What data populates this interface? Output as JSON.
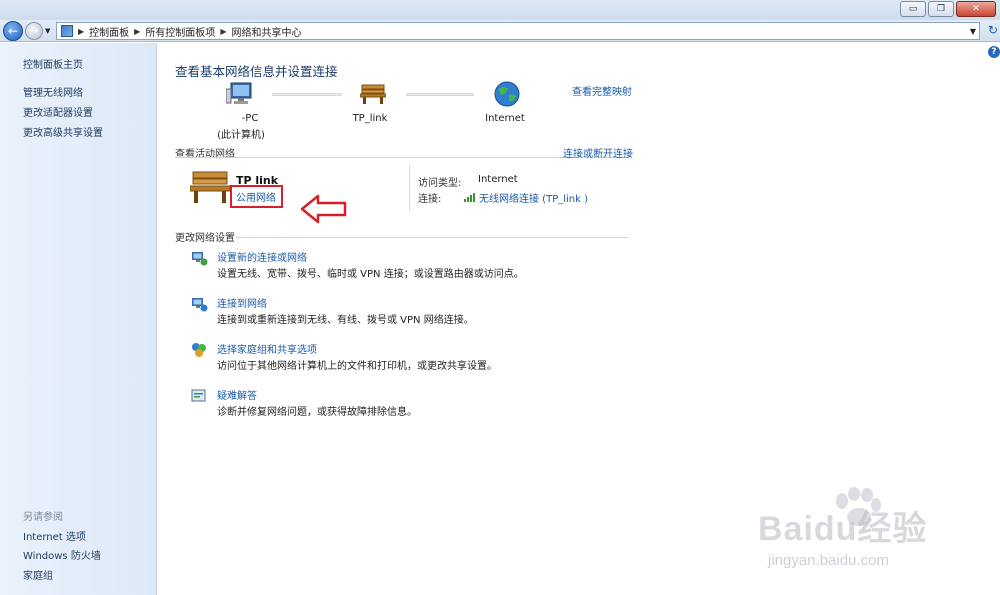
{
  "window": {
    "min_label": "▭",
    "max_label": "❐",
    "close_label": "✕"
  },
  "address": {
    "crumbs": [
      "控制面板",
      "所有控制面板项",
      "网络和共享中心"
    ]
  },
  "sidebar": {
    "items": [
      "控制面板主页",
      "管理无线网络",
      "更改适配器设置",
      "更改高级共享设置"
    ],
    "see_also_heading": "另请参阅",
    "see_also": [
      "Internet 选项",
      "Windows 防火墙",
      "家庭组"
    ]
  },
  "main": {
    "title": "查看基本网络信息并设置连接",
    "full_map_link": "查看完整映射",
    "nodes": {
      "pc_name": "-PC",
      "pc_sub": "(此计算机)",
      "router": "TP_link",
      "internet": "Internet"
    },
    "active_section": {
      "label": "查看活动网络",
      "connect_link": "连接或断开连接",
      "network_name": "TP link",
      "network_type": "公用网络",
      "access_type_label": "访问类型:",
      "access_type_value": "Internet",
      "connections_label": "连接:",
      "connection_value": "无线网络连接 (TP_link    )"
    },
    "change_section": {
      "label": "更改网络设置",
      "tasks": [
        {
          "icon": "network-setup-icon",
          "link": "设置新的连接或网络",
          "desc": "设置无线、宽带、拨号、临时或 VPN 连接；或设置路由器或访问点。"
        },
        {
          "icon": "connect-network-icon",
          "link": "连接到网络",
          "desc": "连接到或重新连接到无线、有线、拨号或 VPN 网络连接。"
        },
        {
          "icon": "homegroup-icon",
          "link": "选择家庭组和共享选项",
          "desc": "访问位于其他网络计算机上的文件和打印机，或更改共享设置。"
        },
        {
          "icon": "troubleshoot-icon",
          "link": "疑难解答",
          "desc": "诊断并修复网络问题，或获得故障排除信息。"
        }
      ]
    }
  },
  "watermark": {
    "brand": "Baidu经验",
    "url": "jingyan.baidu.com"
  },
  "colors": {
    "link": "#1a5aa6",
    "highlight_box": "#d8202a",
    "sidebar_bg": "#e2edf9"
  }
}
